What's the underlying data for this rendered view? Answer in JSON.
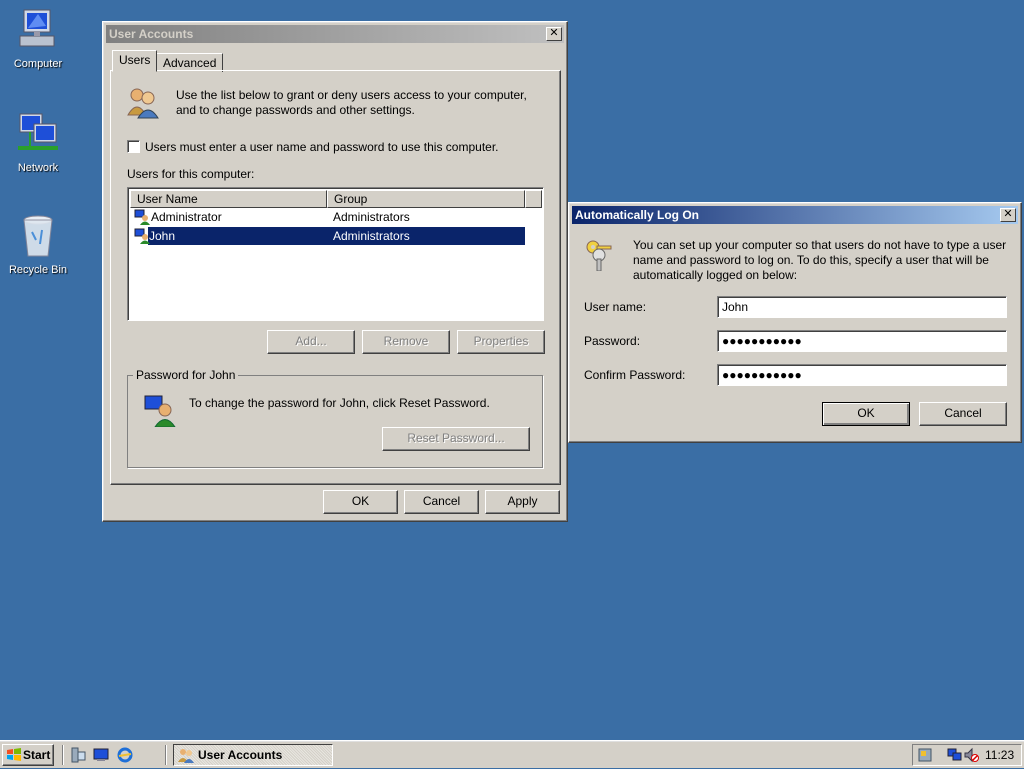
{
  "desktop": {
    "icons": [
      {
        "label": "Computer"
      },
      {
        "label": "Network"
      },
      {
        "label": "Recycle Bin"
      }
    ]
  },
  "user_accounts": {
    "title": "User Accounts",
    "tabs": [
      {
        "label": "Users",
        "active": true
      },
      {
        "label": "Advanced",
        "active": false
      }
    ],
    "intro_text_line1": "Use the list below to grant or deny users access to your computer,",
    "intro_text_line2": "and to change passwords and other settings.",
    "must_enter_checkbox": {
      "label": "Users must enter a user name and password to use this computer.",
      "checked": false
    },
    "users_label": "Users for this computer:",
    "columns": [
      "User Name",
      "Group"
    ],
    "users": [
      {
        "name": "Administrator",
        "group": "Administrators",
        "selected": false
      },
      {
        "name": "John",
        "group": "Administrators",
        "selected": true
      }
    ],
    "add_button": "Add...",
    "remove_button": "Remove",
    "properties_button": "Properties",
    "password_group_title": "Password for John",
    "password_text": "To change the password for John, click Reset Password.",
    "reset_password_button": "Reset Password...",
    "ok_button": "OK",
    "cancel_button": "Cancel",
    "apply_button": "Apply"
  },
  "auto_logon": {
    "title": "Automatically Log On",
    "description_line1": "You can set up your computer so that users do not have to type a user",
    "description_line2": "name and password to log on. To do this, specify a user that will be",
    "description_line3": "automatically logged on below:",
    "username_label": "User name:",
    "username_value": "John",
    "password_label": "Password:",
    "password_value": "●●●●●●●●●●●",
    "confirm_label": "Confirm Password:",
    "confirm_value": "●●●●●●●●●●●",
    "ok_button": "OK",
    "cancel_button": "Cancel"
  },
  "taskbar": {
    "start_label": "Start",
    "task_label": "User Accounts",
    "clock": "11:23"
  },
  "colors": {
    "desktop": "#3a6ea5",
    "face": "#d4d0c8",
    "selection": "#0a246a"
  }
}
